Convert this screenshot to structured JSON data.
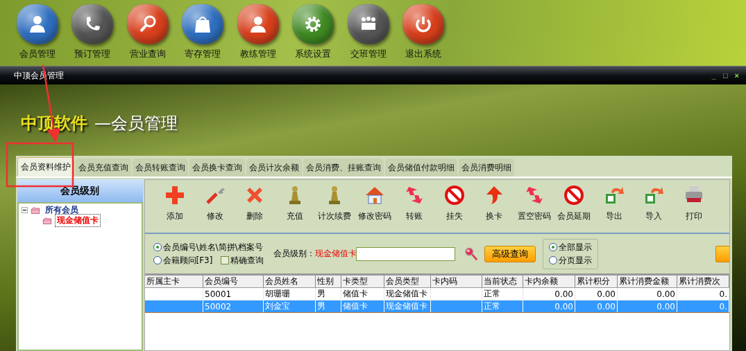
{
  "launcher": [
    {
      "label": "会员管理",
      "kind": "person",
      "color": "#2f6fc0"
    },
    {
      "label": "预订管理",
      "kind": "phone",
      "color": "#555555"
    },
    {
      "label": "营业查询",
      "kind": "magnifier",
      "color": "#d8401c"
    },
    {
      "label": "寄存管理",
      "kind": "bag",
      "color": "#2f6fc0"
    },
    {
      "label": "教练管理",
      "kind": "coach",
      "color": "#d8401c"
    },
    {
      "label": "系统设置",
      "kind": "gear",
      "color": "#3f8a22"
    },
    {
      "label": "交班管理",
      "kind": "meeting",
      "color": "#555555"
    },
    {
      "label": "退出系统",
      "kind": "power",
      "color": "#d8401c"
    }
  ],
  "window": {
    "title": "中顶会员管理",
    "controls": [
      "_",
      "□",
      "×"
    ]
  },
  "banner": {
    "brand": "中顶软件",
    "subtitle": "—会员管理"
  },
  "tabs": [
    {
      "label": "会员资料维护",
      "selected": true
    },
    {
      "label": "会员充值查询",
      "selected": false
    },
    {
      "label": "会员转账查询",
      "selected": false
    },
    {
      "label": "会员换卡查询",
      "selected": false
    },
    {
      "label": "会员计次余额",
      "selected": false
    },
    {
      "label": "会员消费、挂账查询",
      "selected": false
    },
    {
      "label": "会员储值付款明细",
      "selected": false
    },
    {
      "label": "会员消费明细",
      "selected": false
    }
  ],
  "sidebar": {
    "title": "会员级别",
    "tree": [
      {
        "label": "所有会员",
        "expanded": true,
        "selected": false,
        "children": [
          {
            "label": "现金储值卡",
            "selected": true
          }
        ]
      }
    ]
  },
  "toolbar": [
    {
      "label": "添加",
      "kind": "add"
    },
    {
      "label": "修改",
      "kind": "edit"
    },
    {
      "label": "删除",
      "kind": "delete"
    },
    {
      "label": "充值",
      "kind": "pawn"
    },
    {
      "label": "计次续费",
      "kind": "pawn"
    },
    {
      "label": "修改密码",
      "kind": "house"
    },
    {
      "label": "转账",
      "kind": "swap"
    },
    {
      "label": "挂失",
      "kind": "forbid"
    },
    {
      "label": "换卡",
      "kind": "up"
    },
    {
      "label": "置空密码",
      "kind": "swap"
    },
    {
      "label": "会员延期",
      "kind": "forbid"
    },
    {
      "label": "导出",
      "kind": "sheet"
    },
    {
      "label": "导入",
      "kind": "sheet"
    },
    {
      "label": "打印",
      "kind": "printer"
    }
  ],
  "search": {
    "modes": [
      {
        "label": "会员编号\\姓名\\简拼\\档案号",
        "selected": true
      },
      {
        "label": "会籍顾问[F3]",
        "selected": false
      }
    ],
    "exact": {
      "label": "精确查询",
      "checked": false
    },
    "level_label": "会员级别：",
    "level_value": "现金储值卡",
    "advanced_button": "高级查询",
    "display": [
      {
        "label": "全部显示",
        "selected": true
      },
      {
        "label": "分页显示",
        "selected": false
      }
    ]
  },
  "table": {
    "columns": [
      {
        "label": "所属主卡",
        "kind": "text"
      },
      {
        "label": "会员编号",
        "kind": "text"
      },
      {
        "label": "会员姓名",
        "kind": "text"
      },
      {
        "label": "性别",
        "kind": "text"
      },
      {
        "label": "卡类型",
        "kind": "text"
      },
      {
        "label": "会员类型",
        "kind": "text"
      },
      {
        "label": "卡内码",
        "kind": "text"
      },
      {
        "label": "当前状态",
        "kind": "text"
      },
      {
        "label": "卡内余额",
        "kind": "amount"
      },
      {
        "label": "累计积分",
        "kind": "amount"
      },
      {
        "label": "累计消费金额",
        "kind": "amount"
      },
      {
        "label": "累计消费次",
        "kind": "amount"
      }
    ],
    "rows": [
      {
        "selected": false,
        "cells": [
          "",
          "50001",
          "胡珊珊",
          "男",
          "储值卡",
          "现金储值卡",
          "",
          "正常",
          "0.00",
          "0.00",
          "0.00",
          "0."
        ]
      },
      {
        "selected": true,
        "cells": [
          "",
          "50002",
          "刘金宝",
          "男",
          "储值卡",
          "现金储值卡",
          "",
          "正常",
          "0.00",
          "0.00",
          "0.00",
          "0."
        ]
      }
    ]
  }
}
